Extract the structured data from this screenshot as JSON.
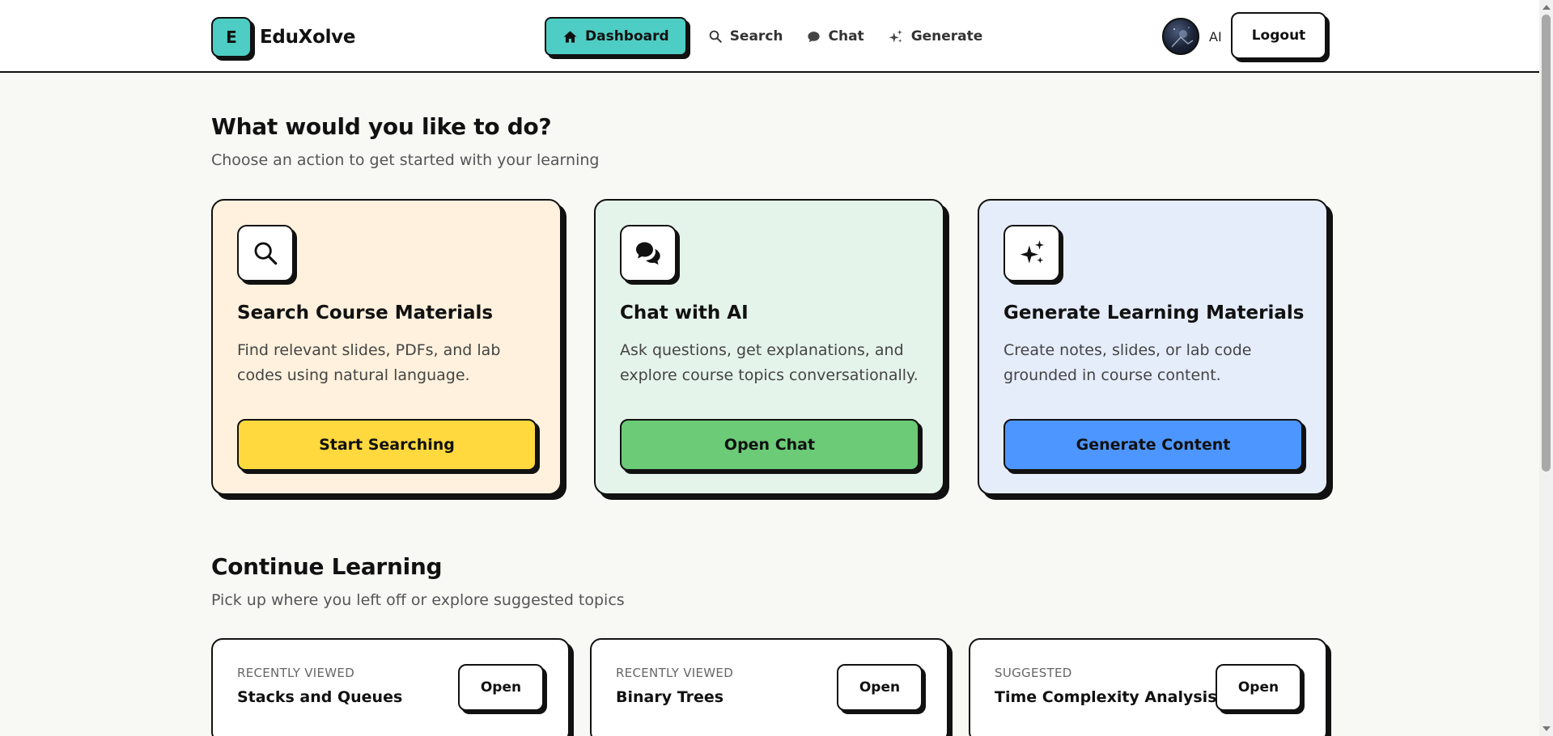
{
  "brand": {
    "badge": "E",
    "name": "EduXolve"
  },
  "nav": {
    "items": [
      {
        "label": "Dashboard",
        "icon": "home-icon",
        "active": true
      },
      {
        "label": "Search",
        "icon": "search-icon"
      },
      {
        "label": "Chat",
        "icon": "chat-icon"
      },
      {
        "label": "Generate",
        "icon": "sparkles-icon"
      }
    ]
  },
  "user": {
    "name": "AI",
    "logout_label": "Logout"
  },
  "actions": {
    "title": "What would you like to do?",
    "subtitle": "Choose an action to get started with your learning",
    "cards": [
      {
        "title": "Search Course Materials",
        "description": "Find relevant slides, PDFs, and lab codes using natural language.",
        "button": "Start Searching",
        "icon": "search-icon",
        "color": "#fff1dd",
        "button_color": "#ffd93d"
      },
      {
        "title": "Chat with AI",
        "description": "Ask questions, get explanations, and explore course topics conversationally.",
        "button": "Open Chat",
        "icon": "chat-icon",
        "color": "#e5f4ea",
        "button_color": "#6bcb77"
      },
      {
        "title": "Generate Learning Materials",
        "description": "Create notes, slides, or lab code grounded in course content.",
        "button": "Generate Content",
        "icon": "sparkles-icon",
        "color": "#e5edfb",
        "button_color": "#4d96ff"
      }
    ]
  },
  "continue": {
    "title": "Continue Learning",
    "subtitle": "Pick up where you left off or explore suggested topics",
    "items": [
      {
        "tag": "RECENTLY VIEWED",
        "title": "Stacks and Queues",
        "button": "Open"
      },
      {
        "tag": "RECENTLY VIEWED",
        "title": "Binary Trees",
        "button": "Open"
      },
      {
        "tag": "SUGGESTED",
        "title": "Time Complexity Analysis",
        "button": "Open"
      }
    ]
  },
  "colors": {
    "accent": "#4ecdc4",
    "background": "#f8f9f5",
    "border": "#111111"
  }
}
